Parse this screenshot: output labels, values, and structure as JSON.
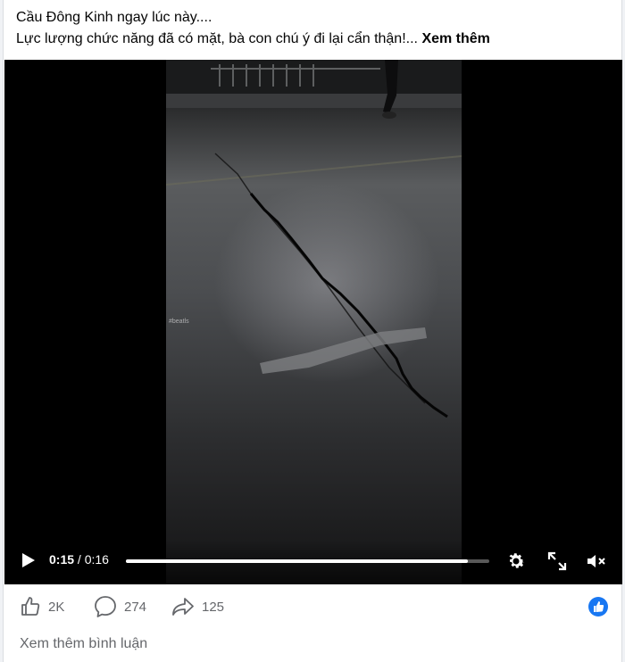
{
  "post": {
    "caption_line1": "Cầu Đông Kinh ngay lúc này....",
    "caption_line2": "Lực lượng chức năng đã có mặt, bà con chú ý đi lại cẩn thận!...",
    "see_more": "Xem thêm"
  },
  "video": {
    "watermark": "#beatls",
    "current_time": "0:15",
    "separator": " / ",
    "duration": "0:16",
    "progress": 0.94,
    "controls": [
      "play-icon",
      "settings-icon",
      "fullscreen-icon",
      "muted-speaker-icon"
    ]
  },
  "actions": {
    "likes": "2K",
    "comments": "274",
    "shares": "125",
    "icons": [
      "thumbs-up-icon",
      "comment-bubble-icon",
      "share-arrow-icon"
    ]
  },
  "footer": {
    "more_comments": "Xem thêm bình luận"
  },
  "colors": {
    "brand": "#1877f2",
    "secondary_text": "#65676b"
  }
}
